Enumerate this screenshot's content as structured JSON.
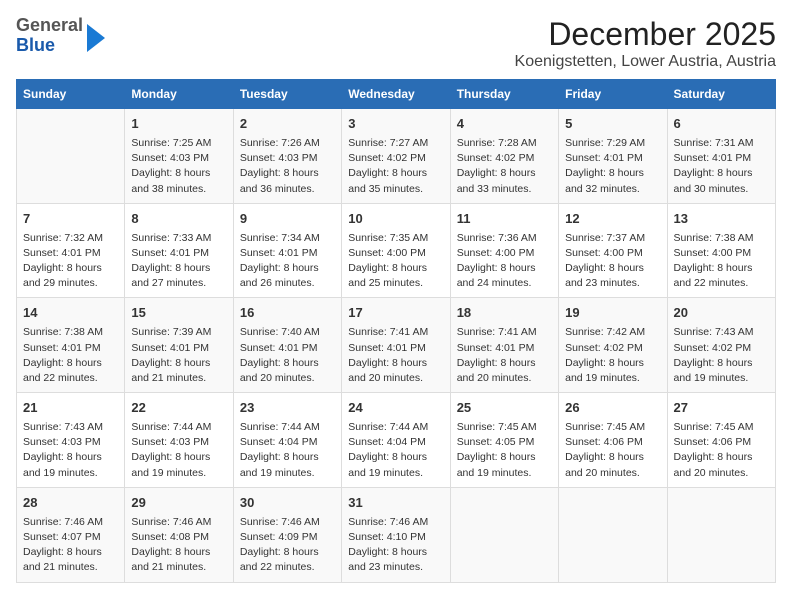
{
  "header": {
    "logo_general": "General",
    "logo_blue": "Blue",
    "title": "December 2025",
    "subtitle": "Koenigstetten, Lower Austria, Austria"
  },
  "columns": [
    "Sunday",
    "Monday",
    "Tuesday",
    "Wednesday",
    "Thursday",
    "Friday",
    "Saturday"
  ],
  "weeks": [
    [
      {
        "day": "",
        "info": ""
      },
      {
        "day": "1",
        "info": "Sunrise: 7:25 AM\nSunset: 4:03 PM\nDaylight: 8 hours\nand 38 minutes."
      },
      {
        "day": "2",
        "info": "Sunrise: 7:26 AM\nSunset: 4:03 PM\nDaylight: 8 hours\nand 36 minutes."
      },
      {
        "day": "3",
        "info": "Sunrise: 7:27 AM\nSunset: 4:02 PM\nDaylight: 8 hours\nand 35 minutes."
      },
      {
        "day": "4",
        "info": "Sunrise: 7:28 AM\nSunset: 4:02 PM\nDaylight: 8 hours\nand 33 minutes."
      },
      {
        "day": "5",
        "info": "Sunrise: 7:29 AM\nSunset: 4:01 PM\nDaylight: 8 hours\nand 32 minutes."
      },
      {
        "day": "6",
        "info": "Sunrise: 7:31 AM\nSunset: 4:01 PM\nDaylight: 8 hours\nand 30 minutes."
      }
    ],
    [
      {
        "day": "7",
        "info": "Sunrise: 7:32 AM\nSunset: 4:01 PM\nDaylight: 8 hours\nand 29 minutes."
      },
      {
        "day": "8",
        "info": "Sunrise: 7:33 AM\nSunset: 4:01 PM\nDaylight: 8 hours\nand 27 minutes."
      },
      {
        "day": "9",
        "info": "Sunrise: 7:34 AM\nSunset: 4:01 PM\nDaylight: 8 hours\nand 26 minutes."
      },
      {
        "day": "10",
        "info": "Sunrise: 7:35 AM\nSunset: 4:00 PM\nDaylight: 8 hours\nand 25 minutes."
      },
      {
        "day": "11",
        "info": "Sunrise: 7:36 AM\nSunset: 4:00 PM\nDaylight: 8 hours\nand 24 minutes."
      },
      {
        "day": "12",
        "info": "Sunrise: 7:37 AM\nSunset: 4:00 PM\nDaylight: 8 hours\nand 23 minutes."
      },
      {
        "day": "13",
        "info": "Sunrise: 7:38 AM\nSunset: 4:00 PM\nDaylight: 8 hours\nand 22 minutes."
      }
    ],
    [
      {
        "day": "14",
        "info": "Sunrise: 7:38 AM\nSunset: 4:01 PM\nDaylight: 8 hours\nand 22 minutes."
      },
      {
        "day": "15",
        "info": "Sunrise: 7:39 AM\nSunset: 4:01 PM\nDaylight: 8 hours\nand 21 minutes."
      },
      {
        "day": "16",
        "info": "Sunrise: 7:40 AM\nSunset: 4:01 PM\nDaylight: 8 hours\nand 20 minutes."
      },
      {
        "day": "17",
        "info": "Sunrise: 7:41 AM\nSunset: 4:01 PM\nDaylight: 8 hours\nand 20 minutes."
      },
      {
        "day": "18",
        "info": "Sunrise: 7:41 AM\nSunset: 4:01 PM\nDaylight: 8 hours\nand 20 minutes."
      },
      {
        "day": "19",
        "info": "Sunrise: 7:42 AM\nSunset: 4:02 PM\nDaylight: 8 hours\nand 19 minutes."
      },
      {
        "day": "20",
        "info": "Sunrise: 7:43 AM\nSunset: 4:02 PM\nDaylight: 8 hours\nand 19 minutes."
      }
    ],
    [
      {
        "day": "21",
        "info": "Sunrise: 7:43 AM\nSunset: 4:03 PM\nDaylight: 8 hours\nand 19 minutes."
      },
      {
        "day": "22",
        "info": "Sunrise: 7:44 AM\nSunset: 4:03 PM\nDaylight: 8 hours\nand 19 minutes."
      },
      {
        "day": "23",
        "info": "Sunrise: 7:44 AM\nSunset: 4:04 PM\nDaylight: 8 hours\nand 19 minutes."
      },
      {
        "day": "24",
        "info": "Sunrise: 7:44 AM\nSunset: 4:04 PM\nDaylight: 8 hours\nand 19 minutes."
      },
      {
        "day": "25",
        "info": "Sunrise: 7:45 AM\nSunset: 4:05 PM\nDaylight: 8 hours\nand 19 minutes."
      },
      {
        "day": "26",
        "info": "Sunrise: 7:45 AM\nSunset: 4:06 PM\nDaylight: 8 hours\nand 20 minutes."
      },
      {
        "day": "27",
        "info": "Sunrise: 7:45 AM\nSunset: 4:06 PM\nDaylight: 8 hours\nand 20 minutes."
      }
    ],
    [
      {
        "day": "28",
        "info": "Sunrise: 7:46 AM\nSunset: 4:07 PM\nDaylight: 8 hours\nand 21 minutes."
      },
      {
        "day": "29",
        "info": "Sunrise: 7:46 AM\nSunset: 4:08 PM\nDaylight: 8 hours\nand 21 minutes."
      },
      {
        "day": "30",
        "info": "Sunrise: 7:46 AM\nSunset: 4:09 PM\nDaylight: 8 hours\nand 22 minutes."
      },
      {
        "day": "31",
        "info": "Sunrise: 7:46 AM\nSunset: 4:10 PM\nDaylight: 8 hours\nand 23 minutes."
      },
      {
        "day": "",
        "info": ""
      },
      {
        "day": "",
        "info": ""
      },
      {
        "day": "",
        "info": ""
      }
    ]
  ]
}
